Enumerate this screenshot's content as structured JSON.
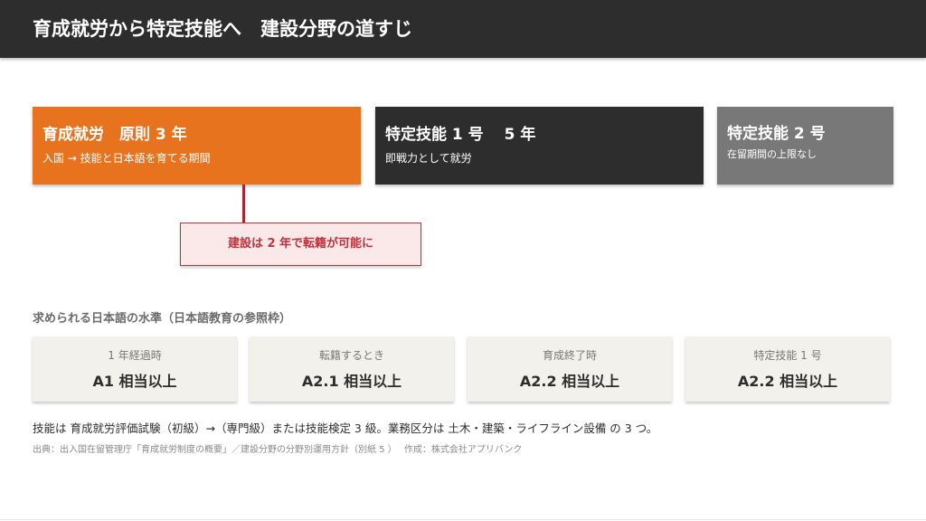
{
  "header": {
    "title": "育成就労から特定技能へ　建設分野の道すじ"
  },
  "stages": [
    {
      "title": "育成就労　原則 3 年",
      "description": "入国 → 技能と日本語を育てる期間"
    },
    {
      "title": "特定技能 1 号　 5 年",
      "description": "即戦力として就労"
    },
    {
      "title": "特定技能 2 号",
      "description": "在留期間の上限なし"
    }
  ],
  "callout": {
    "text": "建設は 2 年で転籍が可能に"
  },
  "japanese_levels": {
    "heading": "求められる日本語の水準（日本語教育の参照枠）",
    "items": [
      {
        "label": "1 年経過時",
        "value": "A1  相当以上"
      },
      {
        "label": "転籍するとき",
        "value": "A2.1  相当以上"
      },
      {
        "label": "育成終了時",
        "value": "A2.2  相当以上"
      },
      {
        "label": "特定技能 1 号",
        "value": "A2.2  相当以上"
      }
    ]
  },
  "note": "技能は 育成就労評価試験（初級）→（専門級）または技能検定 3 級。業務区分は 土木・建築・ライフライン設備 の 3 つ。",
  "source": "出典：出入国在留管理庁「育成就労制度の概要」／建設分野の分野別運用方針（別紙 5 ）　 作成：株式会社アプリバンク",
  "colors": {
    "accent_orange": "#e8731f",
    "dark": "#2d2d2d",
    "gray_stage": "#787878",
    "callout_red": "#c0323c",
    "card_bg": "#f3f1ec"
  }
}
